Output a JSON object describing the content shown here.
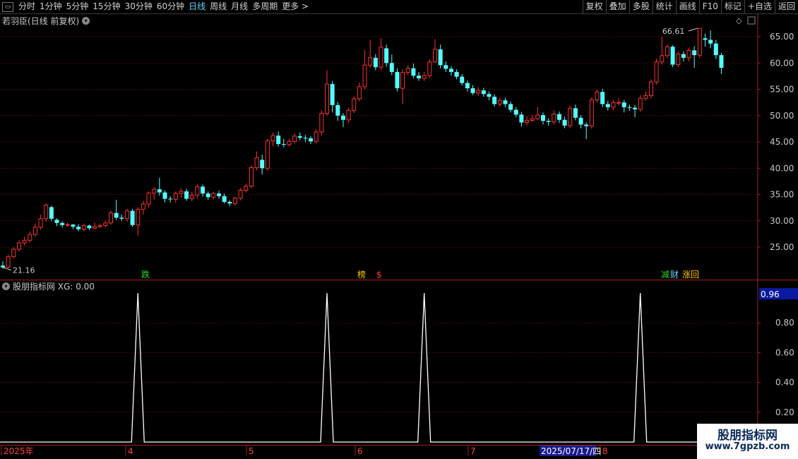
{
  "toolbar": {
    "periods": [
      "分时",
      "1分钟",
      "5分钟",
      "15分钟",
      "30分钟",
      "60分钟",
      "日线",
      "周线",
      "月线",
      "多周期",
      "更多 >"
    ],
    "active_period": "日线",
    "actions": [
      "复权",
      "叠加",
      "多股",
      "统计",
      "画线",
      "F10",
      "标记",
      "+自选",
      "返回"
    ]
  },
  "main_panel": {
    "title": "若羽臣(日线 前复权)",
    "high_label": "66.61",
    "low_label": "21.16",
    "price_ticks": [
      "65.00",
      "60.00",
      "55.00",
      "50.00",
      "45.00",
      "40.00",
      "35.00",
      "30.00",
      "25.00"
    ],
    "event_markers": [
      {
        "text": "跌",
        "color": "#22dd22"
      },
      {
        "text": "榜",
        "color": "#ffcc00"
      },
      {
        "text": "$",
        "color": "#ff3333"
      },
      {
        "text": "减",
        "color": "#22dd22"
      },
      {
        "text": "财",
        "color": "#5fd7ff"
      },
      {
        "text": "涨回",
        "color": "#ffcc00"
      }
    ]
  },
  "indicator_panel": {
    "title": "股朋指标网 XG: 0.00",
    "current_value": "0.96",
    "ticks": [
      "0.80",
      "0.60",
      "0.40",
      "0.20"
    ]
  },
  "date_axis": {
    "labels": [
      "2025年",
      "4",
      "5",
      "6",
      "7",
      "8"
    ],
    "cursor_date": "2025/07/17/四"
  },
  "watermark": {
    "line1": "股朋指标网",
    "line2": "www.7gpzb.com"
  },
  "colors": {
    "up": "#ff3030",
    "down": "#54ffff",
    "grid": "#7a1a1a",
    "axis": "#a02020",
    "active": "#5fd7ff"
  },
  "chart_data": {
    "type": "candlestick",
    "title": "若羽臣(日线 前复权)",
    "ylim": [
      20,
      67
    ],
    "candles": [
      [
        21.5,
        21.16,
        22.3,
        20.9
      ],
      [
        21.2,
        23.2,
        23.6,
        21.0
      ],
      [
        23.2,
        24.6,
        25.0,
        22.9
      ],
      [
        24.6,
        25.8,
        26.3,
        24.2
      ],
      [
        25.8,
        26.3,
        27.0,
        25.3
      ],
      [
        26.3,
        27.4,
        28.0,
        25.9
      ],
      [
        27.4,
        28.8,
        29.5,
        27.0
      ],
      [
        28.8,
        30.4,
        31.2,
        28.3
      ],
      [
        30.4,
        33.0,
        33.3,
        29.8
      ],
      [
        32.6,
        30.4,
        32.9,
        29.9
      ],
      [
        30.2,
        29.6,
        30.5,
        29.0
      ],
      [
        29.6,
        29.2,
        29.9,
        28.7
      ],
      [
        29.2,
        29.3,
        29.7,
        28.8
      ],
      [
        29.3,
        28.9,
        29.4,
        28.4
      ],
      [
        28.9,
        28.4,
        29.4,
        28.0
      ],
      [
        28.4,
        29.1,
        29.5,
        28.0
      ],
      [
        29.1,
        28.6,
        29.3,
        28.2
      ],
      [
        28.6,
        28.9,
        29.7,
        28.4
      ],
      [
        28.9,
        29.1,
        29.5,
        28.6
      ],
      [
        29.1,
        29.6,
        30.0,
        28.8
      ],
      [
        29.6,
        31.5,
        32.0,
        29.3
      ],
      [
        31.5,
        30.6,
        34.0,
        30.2
      ],
      [
        30.6,
        30.4,
        31.2,
        30.0
      ],
      [
        30.4,
        31.9,
        32.3,
        29.9
      ],
      [
        31.9,
        29.2,
        32.3,
        28.9
      ],
      [
        29.2,
        32.2,
        32.6,
        27.2
      ],
      [
        32.2,
        33.2,
        33.8,
        31.2
      ],
      [
        33.2,
        35.3,
        35.6,
        32.5
      ],
      [
        35.3,
        36.0,
        36.4,
        34.0
      ],
      [
        36.0,
        35.4,
        38.2,
        34.8
      ],
      [
        35.4,
        34.2,
        35.8,
        33.5
      ],
      [
        34.2,
        34.1,
        34.7,
        33.5
      ],
      [
        34.1,
        35.2,
        35.6,
        33.4
      ],
      [
        35.2,
        35.6,
        36.2,
        34.4
      ],
      [
        35.6,
        34.2,
        36.1,
        33.8
      ],
      [
        34.2,
        34.9,
        35.5,
        33.7
      ],
      [
        34.9,
        36.5,
        37.0,
        34.3
      ],
      [
        36.5,
        35.2,
        36.9,
        34.6
      ],
      [
        35.2,
        34.5,
        35.6,
        34.0
      ],
      [
        34.5,
        35.2,
        35.5,
        34.1
      ],
      [
        35.2,
        34.7,
        35.7,
        34.2
      ],
      [
        34.7,
        33.6,
        35.2,
        33.3
      ],
      [
        33.6,
        33.3,
        33.9,
        32.8
      ],
      [
        33.3,
        34.3,
        34.6,
        32.9
      ],
      [
        34.3,
        35.8,
        36.3,
        33.9
      ],
      [
        35.8,
        36.6,
        37.1,
        35.4
      ],
      [
        36.6,
        40.1,
        40.6,
        36.2
      ],
      [
        40.1,
        42.0,
        43.2,
        39.6
      ],
      [
        41.6,
        40.0,
        42.6,
        38.8
      ],
      [
        40.0,
        45.2,
        45.6,
        39.5
      ],
      [
        45.2,
        46.2,
        46.8,
        44.2
      ],
      [
        46.2,
        44.6,
        47.0,
        44.1
      ],
      [
        44.6,
        44.5,
        45.6,
        44.0
      ],
      [
        44.5,
        45.1,
        45.6,
        44.1
      ],
      [
        45.1,
        46.1,
        46.6,
        44.7
      ],
      [
        46.1,
        45.8,
        46.8,
        45.3
      ],
      [
        45.8,
        45.7,
        46.3,
        45.0
      ],
      [
        45.7,
        45.1,
        46.1,
        44.6
      ],
      [
        45.1,
        46.9,
        47.4,
        44.7
      ],
      [
        46.9,
        50.4,
        51.0,
        46.2
      ],
      [
        50.4,
        56.0,
        58.6,
        50.0
      ],
      [
        56.0,
        52.0,
        56.6,
        50.6
      ],
      [
        52.0,
        50.0,
        52.6,
        49.0
      ],
      [
        50.0,
        49.2,
        50.5,
        47.8
      ],
      [
        49.2,
        51.0,
        51.5,
        48.6
      ],
      [
        51.0,
        53.2,
        53.7,
        50.5
      ],
      [
        53.2,
        55.5,
        56.3,
        52.7
      ],
      [
        55.5,
        59.6,
        62.5,
        55.0
      ],
      [
        59.6,
        61.0,
        64.4,
        59.1
      ],
      [
        61.0,
        59.2,
        61.7,
        58.6
      ],
      [
        59.2,
        63.0,
        64.7,
        58.6
      ],
      [
        62.8,
        60.0,
        63.5,
        59.3
      ],
      [
        60.0,
        58.3,
        61.6,
        57.7
      ],
      [
        58.3,
        55.2,
        59.0,
        54.6
      ],
      [
        55.2,
        58.2,
        58.8,
        52.2
      ],
      [
        58.2,
        59.0,
        59.6,
        57.7
      ],
      [
        59.0,
        57.6,
        59.9,
        57.1
      ],
      [
        57.6,
        57.1,
        58.3,
        56.6
      ],
      [
        57.1,
        57.6,
        58.3,
        56.6
      ],
      [
        57.6,
        60.2,
        60.7,
        57.1
      ],
      [
        60.2,
        62.6,
        64.5,
        60.0
      ],
      [
        62.6,
        59.6,
        63.5,
        59.0
      ],
      [
        59.6,
        58.9,
        60.3,
        58.3
      ],
      [
        58.9,
        58.3,
        59.4,
        57.6
      ],
      [
        58.3,
        57.4,
        58.8,
        56.9
      ],
      [
        57.4,
        56.2,
        57.9,
        55.7
      ],
      [
        56.2,
        55.2,
        56.7,
        54.6
      ],
      [
        55.2,
        54.3,
        55.8,
        53.9
      ],
      [
        54.3,
        54.8,
        55.4,
        53.8
      ],
      [
        54.8,
        54.1,
        55.3,
        53.6
      ],
      [
        54.1,
        53.6,
        54.6,
        52.9
      ],
      [
        53.6,
        52.2,
        54.1,
        51.7
      ],
      [
        52.2,
        52.9,
        53.4,
        51.7
      ],
      [
        52.9,
        52.2,
        53.4,
        51.6
      ],
      [
        52.2,
        51.1,
        52.7,
        50.6
      ],
      [
        51.1,
        50.2,
        51.6,
        49.7
      ],
      [
        50.2,
        48.7,
        50.7,
        47.9
      ],
      [
        48.7,
        49.1,
        49.9,
        48.1
      ],
      [
        49.1,
        49.4,
        50.1,
        48.8
      ],
      [
        49.4,
        50.1,
        51.7,
        49.1
      ],
      [
        50.1,
        49.0,
        50.6,
        48.3
      ],
      [
        49.0,
        48.8,
        49.5,
        48.1
      ],
      [
        48.8,
        50.3,
        51.0,
        48.3
      ],
      [
        50.3,
        49.2,
        50.8,
        48.6
      ],
      [
        49.2,
        48.1,
        49.8,
        47.6
      ],
      [
        48.1,
        51.4,
        51.9,
        47.6
      ],
      [
        51.4,
        49.6,
        52.1,
        49.1
      ],
      [
        49.6,
        48.3,
        50.1,
        47.6
      ],
      [
        48.3,
        48.0,
        48.7,
        45.5
      ],
      [
        48.0,
        53.0,
        53.5,
        47.5
      ],
      [
        53.0,
        54.5,
        55.0,
        52.5
      ],
      [
        54.5,
        52.2,
        55.1,
        51.6
      ],
      [
        52.2,
        51.6,
        52.8,
        51.0
      ],
      [
        51.6,
        52.5,
        53.0,
        51.0
      ],
      [
        52.5,
        52.5,
        53.3,
        51.9
      ],
      [
        52.5,
        51.6,
        53.0,
        50.6
      ],
      [
        51.6,
        51.5,
        52.1,
        50.9
      ],
      [
        51.5,
        51.2,
        52.0,
        49.7
      ],
      [
        51.2,
        53.3,
        53.9,
        50.7
      ],
      [
        53.3,
        53.8,
        54.6,
        52.8
      ],
      [
        53.8,
        56.4,
        56.9,
        53.3
      ],
      [
        56.4,
        60.2,
        60.9,
        55.9
      ],
      [
        60.2,
        61.4,
        65.0,
        59.7
      ],
      [
        61.4,
        63.1,
        63.6,
        60.9
      ],
      [
        63.1,
        59.7,
        63.4,
        59.2
      ],
      [
        59.7,
        61.7,
        62.2,
        59.2
      ],
      [
        61.7,
        61.0,
        62.2,
        60.3
      ],
      [
        61.0,
        62.4,
        62.9,
        60.3
      ],
      [
        62.4,
        61.5,
        63.2,
        59.1
      ],
      [
        61.5,
        66.6,
        66.61,
        60.9
      ],
      [
        64.7,
        64.4,
        65.6,
        63.1
      ],
      [
        64.4,
        63.7,
        66.2,
        62.8
      ],
      [
        63.7,
        61.5,
        64.4,
        60.8
      ],
      [
        61.5,
        59.1,
        61.9,
        57.9
      ]
    ],
    "indicator": {
      "name": "XG",
      "ylim": [
        0,
        1
      ],
      "spikes_at_candle_index": [
        25,
        60,
        78,
        118
      ]
    }
  }
}
